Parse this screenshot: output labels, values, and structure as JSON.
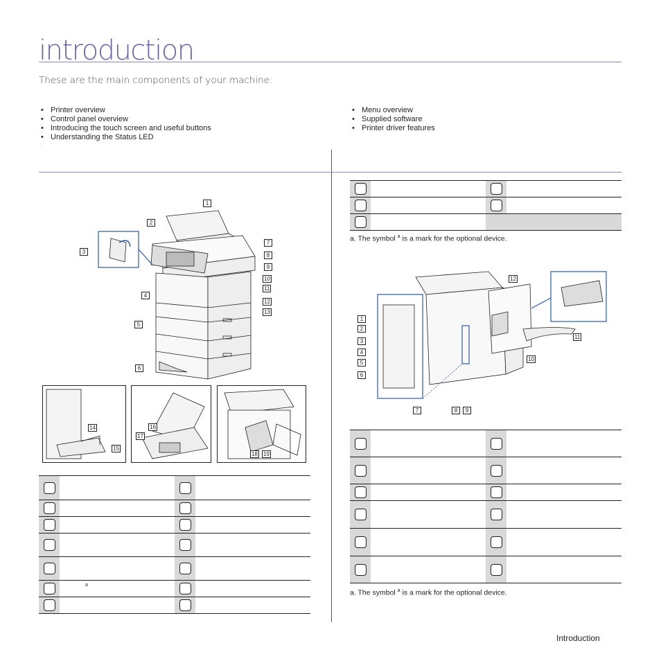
{
  "page": {
    "title": "introduction",
    "subtitle": "These are the main components of your machine:",
    "footer": "Introduction"
  },
  "toc": {
    "left": [
      "Printer overview",
      "Control panel overview",
      "Introducing the touch screen and useful buttons",
      "Understanding the Status LED"
    ],
    "right": [
      "Menu overview",
      "Supplied software",
      "Printer driver features"
    ],
    "stray_mark": "·"
  },
  "front_view": {
    "callouts": [
      "1",
      "2",
      "3",
      "4",
      "5",
      "6",
      "7",
      "8",
      "9",
      "10",
      "11",
      "12",
      "13"
    ],
    "inset_callouts": [
      "14",
      "15",
      "16",
      "17",
      "18",
      "19"
    ],
    "table_rows": [
      {
        "left_marker": "",
        "right_marker": ""
      },
      {
        "left_marker": "",
        "right_marker": ""
      },
      {
        "left_marker": "",
        "right_marker": ""
      },
      {
        "left_marker": "",
        "right_marker": ""
      },
      {
        "left_marker": "",
        "right_marker": ""
      },
      {
        "left_marker": "a",
        "right_marker": ""
      },
      {
        "left_marker": "",
        "right_marker": ""
      }
    ]
  },
  "rear_view": {
    "top_table_rows": 3,
    "top_note_prefix": "a. The symbol ",
    "top_note_sup": "a",
    "top_note_suffix": " is a mark for the optional device.",
    "callouts": [
      "1",
      "2",
      "3",
      "4",
      "5",
      "6",
      "7",
      "8",
      "9",
      "10",
      "11",
      "12"
    ],
    "table_rows": 6,
    "note_prefix": "a. The symbol ",
    "note_sup": "a",
    "note_suffix": " is a mark for the optional device."
  }
}
